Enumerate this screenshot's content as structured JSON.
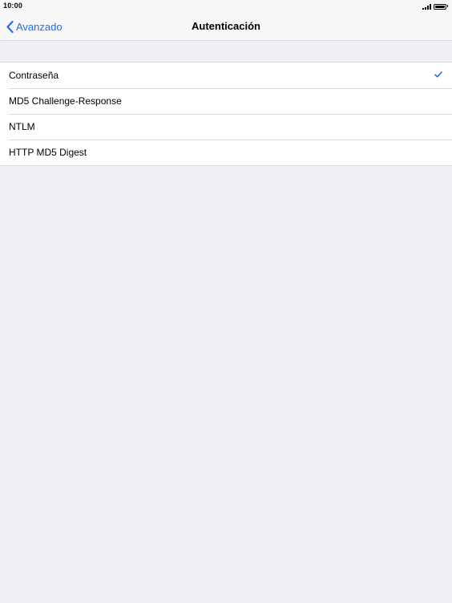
{
  "status_bar": {
    "time": "10:00"
  },
  "nav": {
    "back_label": "Avanzado",
    "title": "Autenticación"
  },
  "list": {
    "items": [
      {
        "label": "Contraseña",
        "selected": true
      },
      {
        "label": "MD5 Challenge-Response",
        "selected": false
      },
      {
        "label": "NTLM",
        "selected": false
      },
      {
        "label": "HTTP MD5 Digest",
        "selected": false
      }
    ]
  },
  "colors": {
    "accent": "#1f6ff0",
    "background": "#efeff4",
    "bar": "#f7f7f7"
  },
  "icons": {
    "back": "chevron-left-icon",
    "check": "checkmark-icon",
    "signal": "signal-bars-icon",
    "battery": "battery-icon"
  }
}
